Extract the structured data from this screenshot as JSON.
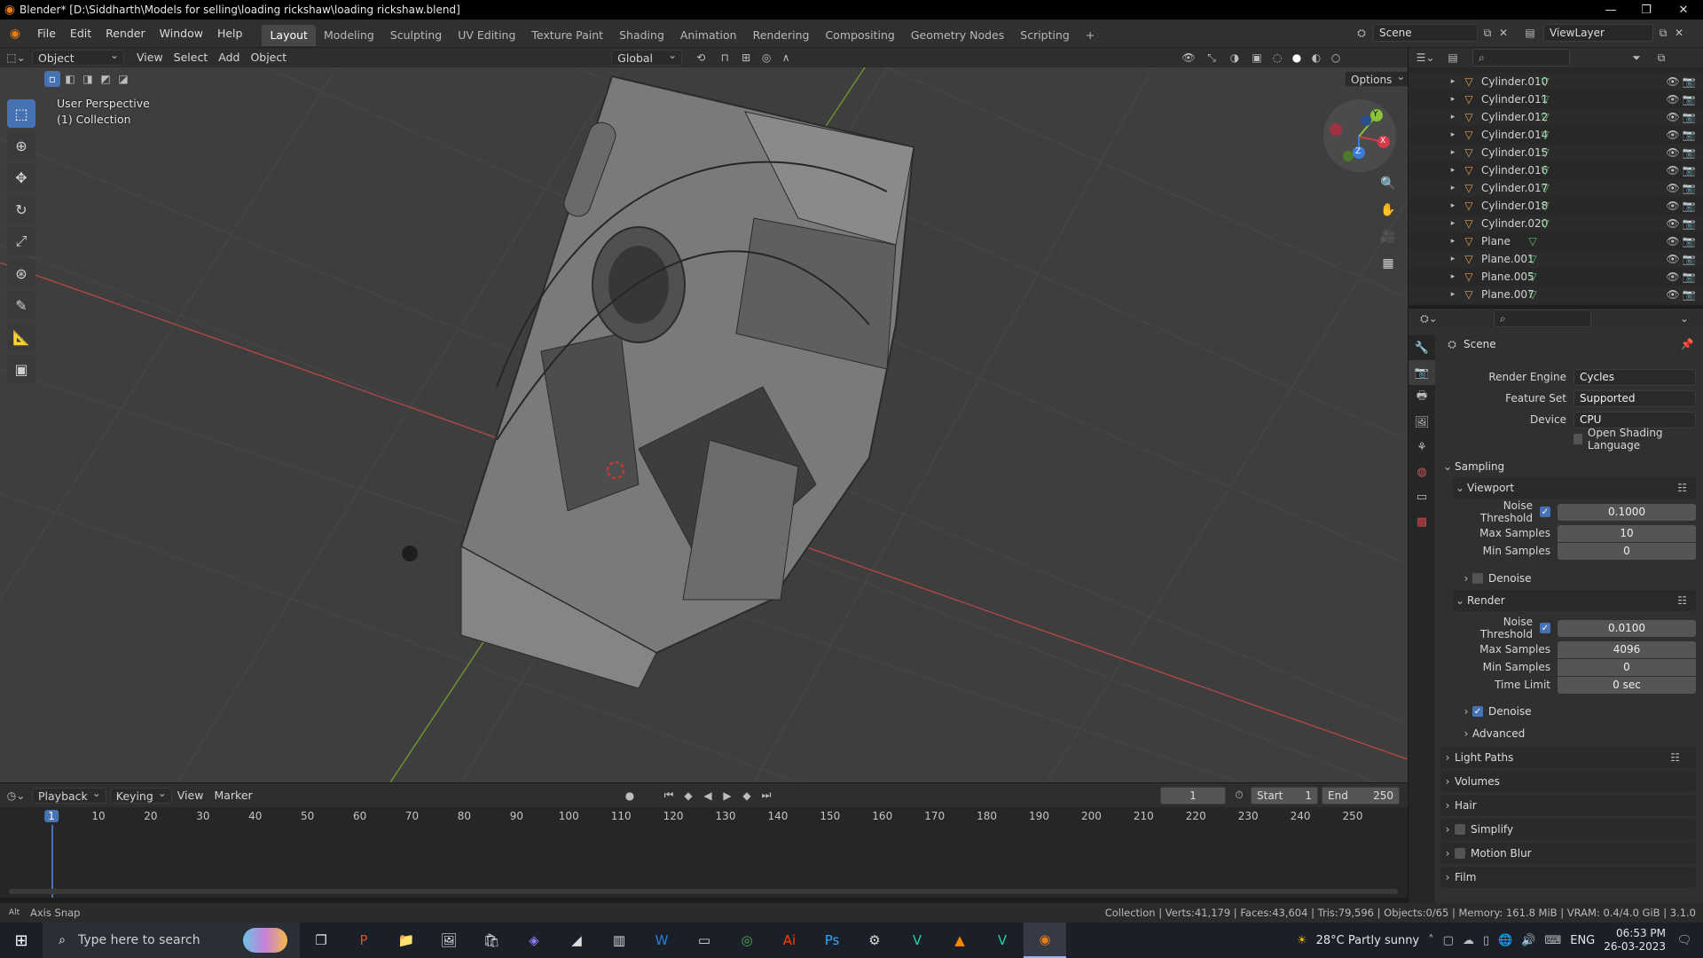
{
  "titlebar": {
    "title": "Blender* [D:\\Siddharth\\Models for selling\\loading rickshaw\\loading rickshaw.blend]",
    "min": "—",
    "max": "❐",
    "close": "✕"
  },
  "menus": [
    "File",
    "Edit",
    "Render",
    "Window",
    "Help"
  ],
  "workspaces": [
    "Layout",
    "Modeling",
    "Sculpting",
    "UV Editing",
    "Texture Paint",
    "Shading",
    "Animation",
    "Rendering",
    "Compositing",
    "Geometry Nodes",
    "Scripting"
  ],
  "topright": {
    "scene": "Scene",
    "viewlayer": "ViewLayer",
    "add_tab": "+"
  },
  "vp_header": {
    "mode": "Object Mode",
    "menus": [
      "View",
      "Select",
      "Add",
      "Object"
    ],
    "orientation": "Global",
    "options": "Options"
  },
  "viewport": {
    "perspective": "User Perspective",
    "collection": "(1) Collection"
  },
  "gizmo": {
    "x": "X",
    "y": "Y",
    "z": "Z"
  },
  "outliner": {
    "rows": [
      "Cylinder.010",
      "Cylinder.011",
      "Cylinder.012",
      "Cylinder.014",
      "Cylinder.015",
      "Cylinder.016",
      "Cylinder.017",
      "Cylinder.018",
      "Cylinder.020",
      "Plane",
      "Plane.001",
      "Plane.005",
      "Plane.007"
    ]
  },
  "props": {
    "scene_label": "Scene",
    "render_engine_label": "Render Engine",
    "render_engine": "Cycles",
    "feature_set_label": "Feature Set",
    "feature_set": "Supported",
    "device_label": "Device",
    "device": "CPU",
    "osl_label": "Open Shading Language",
    "sampling": "Sampling",
    "viewport": "Viewport",
    "noise_threshold_label": "Noise Threshold",
    "vp_noise_threshold": "0.1000",
    "max_samples_label": "Max Samples",
    "vp_max_samples": "10",
    "min_samples_label": "Min Samples",
    "vp_min_samples": "0",
    "denoise": "Denoise",
    "render": "Render",
    "r_noise_threshold": "0.0100",
    "r_max_samples": "4096",
    "r_min_samples": "0",
    "time_limit_label": "Time Limit",
    "time_limit": "0 sec",
    "advanced": "Advanced",
    "light_paths": "Light Paths",
    "volumes": "Volumes",
    "hair": "Hair",
    "simplify": "Simplify",
    "motion_blur": "Motion Blur",
    "film": "Film"
  },
  "timeline": {
    "menus": [
      "Playback",
      "Keying",
      "View",
      "Marker"
    ],
    "current_frame": "1",
    "start_label": "Start",
    "start": "1",
    "end_label": "End",
    "end": "250",
    "ticks": [
      "1",
      "10",
      "20",
      "30",
      "40",
      "50",
      "60",
      "70",
      "80",
      "90",
      "100",
      "110",
      "120",
      "130",
      "140",
      "150",
      "160",
      "170",
      "180",
      "190",
      "200",
      "210",
      "220",
      "230",
      "240",
      "250"
    ]
  },
  "statusbar": {
    "left": "Axis Snap",
    "right": "Collection | Verts:41,179 | Faces:43,604 | Tris:79,596 | Objects:0/65 | Memory: 161.8 MiB | VRAM: 0.4/4.0 GiB | 3.1.0"
  },
  "taskbar": {
    "search": "Type here to search",
    "weather": "28°C  Partly sunny",
    "lang": "ENG",
    "time": "06:53 PM",
    "date": "26-03-2023"
  }
}
